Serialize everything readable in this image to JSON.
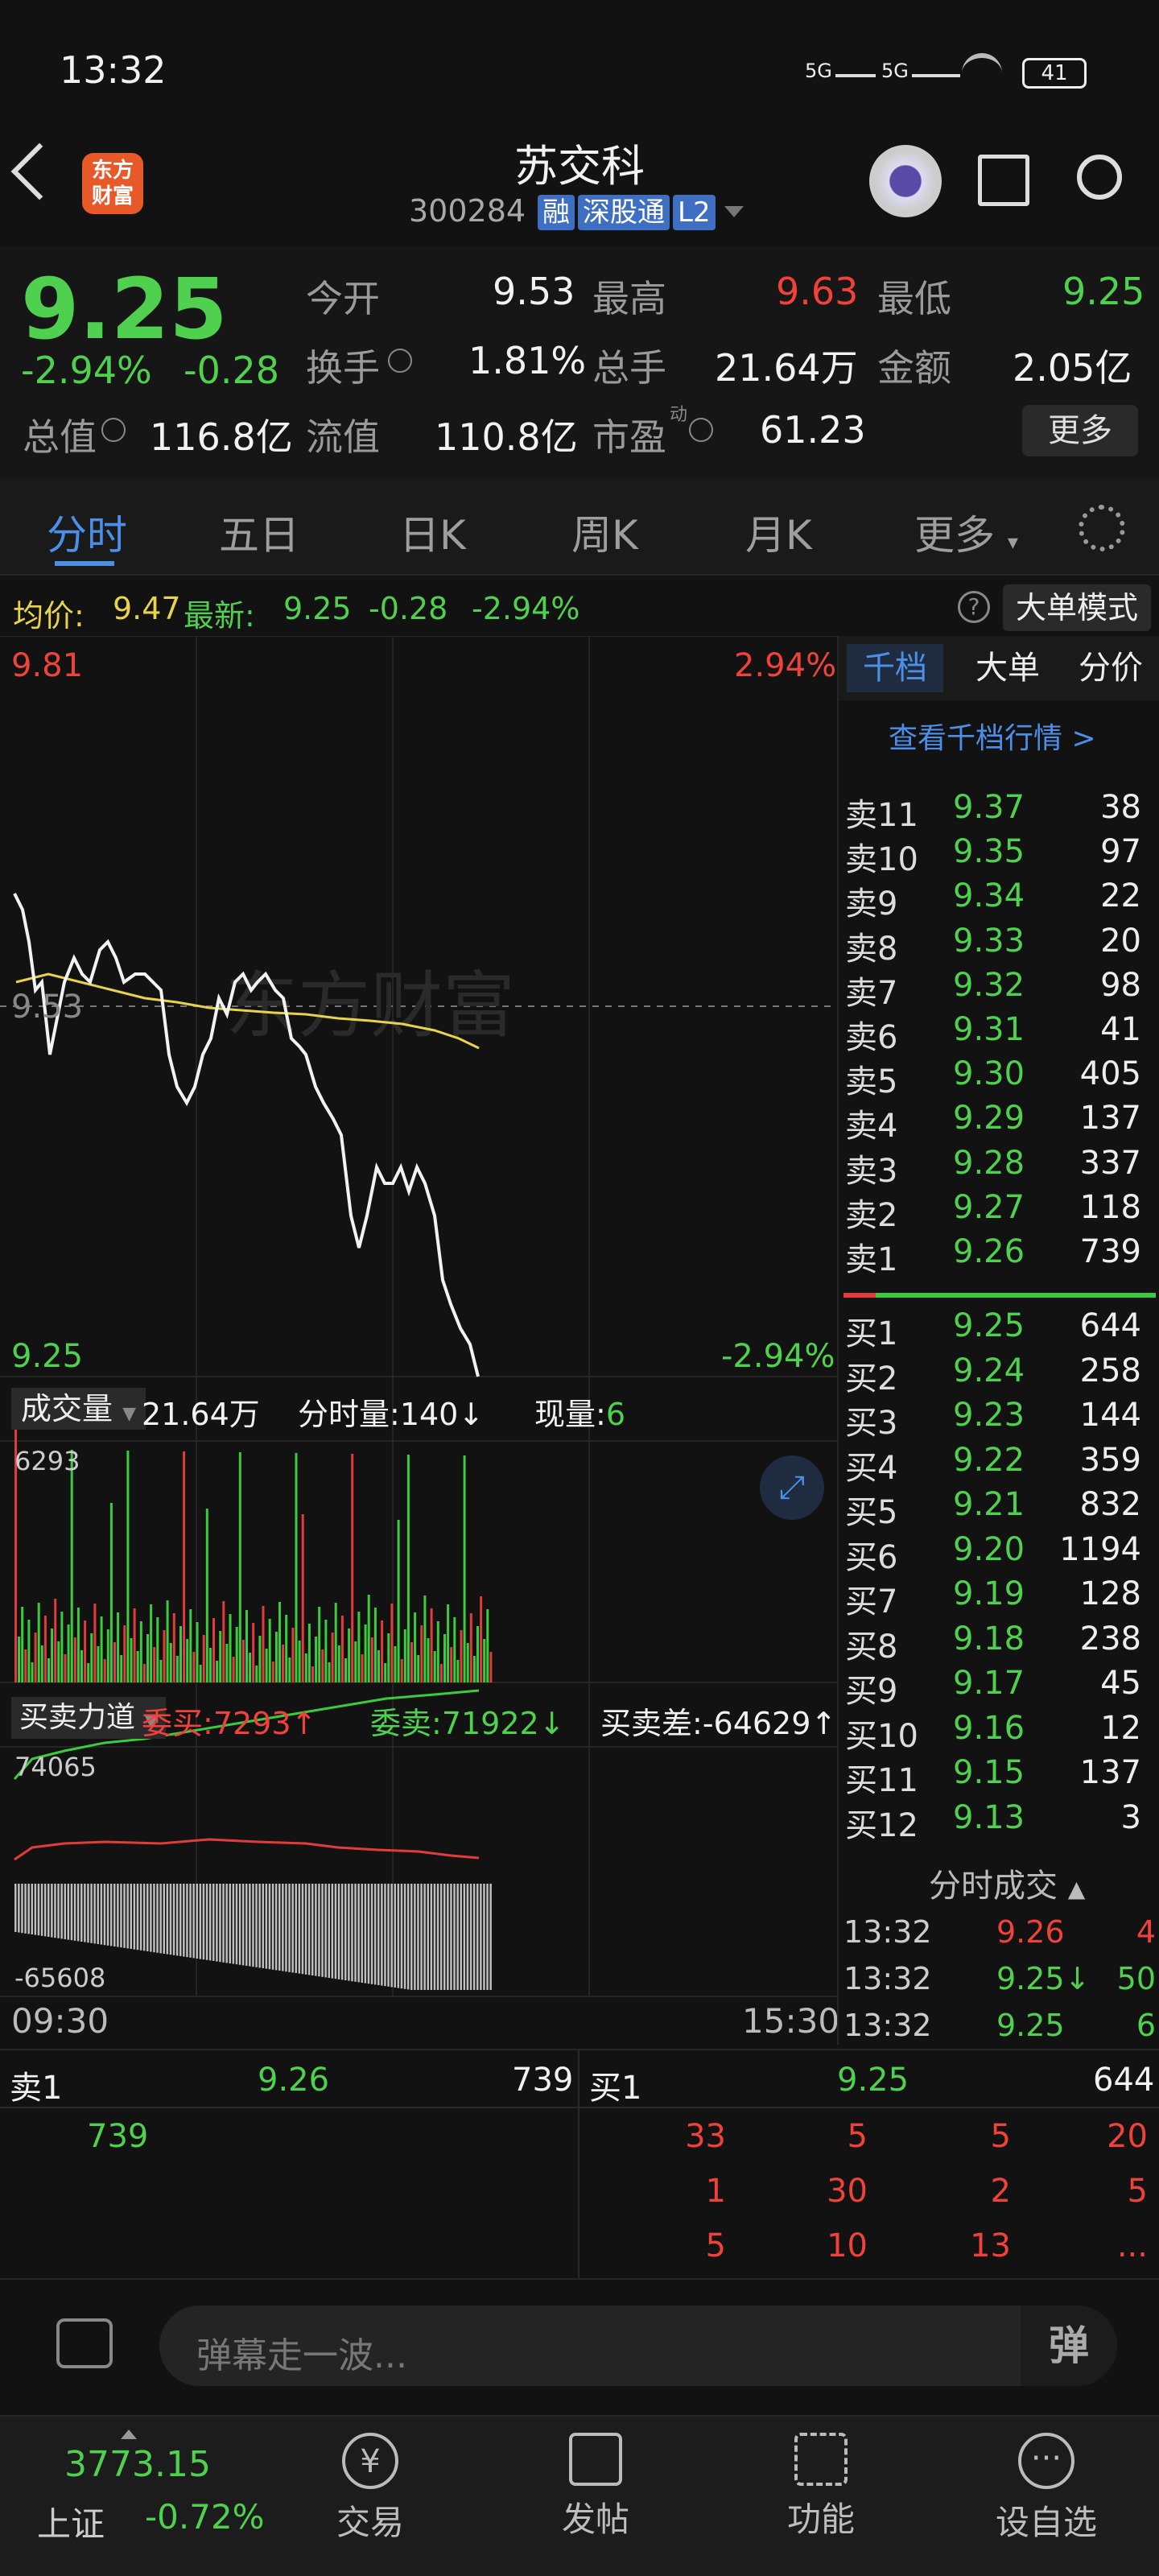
{
  "status": {
    "time": "13:32",
    "battery": "41",
    "net1": "5G",
    "net2": "5G"
  },
  "header": {
    "title": "苏交科",
    "code": "300284",
    "tag_rong": "融",
    "tag_sgt": "深股通",
    "tag_l2": "L2",
    "logo_line1": "东方",
    "logo_line2": "财富"
  },
  "quote": {
    "price": "9.25",
    "change_pct": "-2.94%",
    "change": "-0.28",
    "open_label": "今开",
    "open": "9.53",
    "high_label": "最高",
    "high": "9.63",
    "low_label": "最低",
    "low": "9.25",
    "turnover_label": "换手",
    "turnover": "1.81%",
    "volume_label": "总手",
    "volume": "21.64万",
    "amount_label": "金额",
    "amount": "2.05亿",
    "mktcap_label": "总值",
    "mktcap": "116.8亿",
    "float_label": "流值",
    "float": "110.8亿",
    "pe_label": "市盈",
    "pe_sup": "动",
    "pe": "61.23",
    "more": "更多"
  },
  "tabs": [
    "分时",
    "五日",
    "日K",
    "周K",
    "月K",
    "更多"
  ],
  "avgbar": {
    "avg_label": "均价:",
    "avg": "9.47",
    "latest_label": "最新:",
    "latest": "9.25",
    "chg": "-0.28",
    "pct": "-2.94%",
    "mode_btn": "大单模式"
  },
  "chart": {
    "y_top": "9.81",
    "y_top_pct": "2.94%",
    "y_mid": "9.53",
    "y_bot": "9.25",
    "y_bot_pct": "-2.94%",
    "watermark": "东方财富",
    "vol_label": "成交量",
    "vol_total": "21.64万",
    "vol_min_label": "分时量:",
    "vol_min": "140↓",
    "vol_now_label": "现量:",
    "vol_now": "6",
    "vol_max": "6293",
    "force_label": "买卖力道",
    "buy_label": "委买:",
    "buy": "7293↑",
    "sell_label": "委卖:",
    "sell": "71922↓",
    "diff_label": "买卖差:",
    "diff": "-64629↑",
    "force_max": "74065",
    "force_min": "-65608",
    "time_start": "09:30",
    "time_end": "15:30"
  },
  "orderbook": {
    "tabs": [
      "千档",
      "大单",
      "分价"
    ],
    "link": "查看千档行情 >",
    "sells": [
      {
        "label": "卖11",
        "price": "9.37",
        "vol": "38"
      },
      {
        "label": "卖10",
        "price": "9.35",
        "vol": "97"
      },
      {
        "label": "卖9",
        "price": "9.34",
        "vol": "22"
      },
      {
        "label": "卖8",
        "price": "9.33",
        "vol": "20"
      },
      {
        "label": "卖7",
        "price": "9.32",
        "vol": "98"
      },
      {
        "label": "卖6",
        "price": "9.31",
        "vol": "41"
      },
      {
        "label": "卖5",
        "price": "9.30",
        "vol": "405"
      },
      {
        "label": "卖4",
        "price": "9.29",
        "vol": "137"
      },
      {
        "label": "卖3",
        "price": "9.28",
        "vol": "337"
      },
      {
        "label": "卖2",
        "price": "9.27",
        "vol": "118"
      },
      {
        "label": "卖1",
        "price": "9.26",
        "vol": "739"
      }
    ],
    "buys": [
      {
        "label": "买1",
        "price": "9.25",
        "vol": "644"
      },
      {
        "label": "买2",
        "price": "9.24",
        "vol": "258"
      },
      {
        "label": "买3",
        "price": "9.23",
        "vol": "144"
      },
      {
        "label": "买4",
        "price": "9.22",
        "vol": "359"
      },
      {
        "label": "买5",
        "price": "9.21",
        "vol": "832"
      },
      {
        "label": "买6",
        "price": "9.20",
        "vol": "1194"
      },
      {
        "label": "买7",
        "price": "9.19",
        "vol": "128"
      },
      {
        "label": "买8",
        "price": "9.18",
        "vol": "238"
      },
      {
        "label": "买9",
        "price": "9.17",
        "vol": "45"
      },
      {
        "label": "买10",
        "price": "9.16",
        "vol": "12"
      },
      {
        "label": "买11",
        "price": "9.15",
        "vol": "137"
      },
      {
        "label": "买12",
        "price": "9.13",
        "vol": "3"
      }
    ],
    "ticks_label": "分时成交",
    "ticks": [
      {
        "t": "13:32",
        "p": "9.26",
        "v": "4"
      },
      {
        "t": "13:32",
        "p": "9.25↓",
        "v": "50"
      },
      {
        "t": "13:32",
        "p": "9.25",
        "v": "6"
      }
    ]
  },
  "queue": {
    "sell_label": "卖1",
    "sell_price": "9.26",
    "sell_vol": "739",
    "sell_item": "739",
    "buy_label": "买1",
    "buy_price": "9.25",
    "buy_vol": "644",
    "buy_items": [
      "33",
      "5",
      "5",
      "20",
      "1",
      "30",
      "2",
      "5",
      "5",
      "10",
      "13",
      "..."
    ]
  },
  "danmu": {
    "placeholder": "弹幕走一波...",
    "btn": "弹"
  },
  "nav": {
    "index_value": "3773.15",
    "index_name": "上证",
    "index_pct": "-0.72%",
    "items": [
      "交易",
      "发帖",
      "功能",
      "设自选"
    ]
  }
}
